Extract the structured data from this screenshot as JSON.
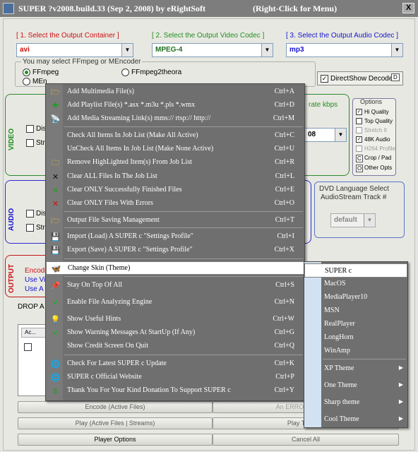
{
  "window": {
    "title": "SUPER ?v2008.build.33 (Sep 2, 2008) by eRightSoft",
    "hint": "(Right-Click for Menu)",
    "close": "X"
  },
  "top": {
    "container_label": "[ 1.     Select the Output Container ]",
    "video_codec_label": "[ 2.    Select the Output Video Codec ]",
    "audio_codec_label": "[ 3.    Select the Output Audio Codec ]",
    "container_value": "avi",
    "video_codec_value": "MPEG-4",
    "audio_codec_value": "mp3"
  },
  "encoder": {
    "caption": "You may select FFmpeg or MEncoder",
    "ffmpeg": "FFmpeg",
    "ffmpeg2theora": "FFmpeg2theora",
    "mencoder": "MEn"
  },
  "directshow": {
    "label": "DirectShow Decode",
    "badge": "D"
  },
  "video": {
    "section": "VIDEO",
    "disable": "Disa",
    "stream": "Stre",
    "bitrate": "rate  kbps",
    "value": "08"
  },
  "options": {
    "title": "Options",
    "hi_quality": "Hi Quality",
    "top_quality": "Top Quality",
    "stretch": "Stretch It",
    "audio_48k": "48K Audio",
    "h264": "H264 Profile",
    "crop_badge": "C",
    "crop": "Crop / Pad",
    "other_badge": "O",
    "other": "Other Opts"
  },
  "audio": {
    "section": "AUDIO",
    "disable": "Disa",
    "stream": "Stre"
  },
  "dvd": {
    "title": "DVD Language Select",
    "subtitle": "AudioStream  Track #",
    "value": "default"
  },
  "output": {
    "section": "OUTPUT",
    "encode_line": "Encode",
    "usevi_line": "Use Vi",
    "useav_line": "Use A"
  },
  "drop": {
    "text": "DROP A"
  },
  "list": {
    "header": "Ac..."
  },
  "buttons": {
    "encode": "Encode (Active Files)",
    "error": "An ERROR has occu",
    "play": "Play (Active Files | Streams)",
    "play_last": "Play The Las",
    "player_options": "Player Options",
    "cancel": "Cancel All"
  },
  "context_menu": [
    {
      "icon": "folder-add-icon",
      "glyph": "🗁",
      "text": "Add Multimedia File(s)",
      "shortcut": "Ctrl+A"
    },
    {
      "icon": "plus-icon",
      "glyph": "✚",
      "text": "Add Playlist File(s)    *.asx  *.m3u  *.pls  *.wmx",
      "shortcut": "Ctrl+D"
    },
    {
      "icon": "satellite-icon",
      "glyph": "📡",
      "text": "Add Media Streaming Link(s)    mms://  rtsp://  http://",
      "shortcut": "Ctrl+M"
    },
    {
      "icon": "",
      "glyph": "",
      "text": "Check All Items In Job List (Make All Active)",
      "shortcut": "Ctrl+C"
    },
    {
      "icon": "",
      "glyph": "",
      "text": "UnCheck All Items In Job List (Make None Active)",
      "shortcut": "Ctrl+U"
    },
    {
      "icon": "folder-icon",
      "glyph": "🗀",
      "text": "Remove HighLighted Item(s) From Job List",
      "shortcut": "Ctrl+R"
    },
    {
      "icon": "x-mark-icon",
      "glyph": "✕",
      "text": "Clear ALL Files In The Job List",
      "shortcut": "Ctrl+L"
    },
    {
      "icon": "x-mark-green-icon",
      "glyph": "✕",
      "text": "Clear ONLY Successfully Finished Files",
      "shortcut": "Ctrl+E"
    },
    {
      "icon": "x-mark-red-icon",
      "glyph": "✕",
      "text": "Clear ONLY Files With Errors",
      "shortcut": "Ctrl+O"
    },
    {
      "icon": "folder-open-icon",
      "glyph": "🗁",
      "text": "Output File Saving Management",
      "shortcut": "Ctrl+T"
    },
    {
      "icon": "floppy-icon",
      "glyph": "💾",
      "text": "Import (Load) A SUPER c \"Settings Profile\"",
      "shortcut": "Ctrl+I"
    },
    {
      "icon": "floppy-icon",
      "glyph": "💾",
      "text": "Export (Save) A SUPER c \"Settings Profile\"",
      "shortcut": "Ctrl+X"
    },
    {
      "icon": "butterfly-icon",
      "glyph": "🦋",
      "text": "Change Skin (Theme)",
      "shortcut": ""
    },
    {
      "icon": "pin-icon",
      "glyph": "📌",
      "text": "Stay On Top Of All",
      "shortcut": "Ctrl+S"
    },
    {
      "icon": "checkmark-icon",
      "glyph": "✔",
      "text": "Enable File Analyzing Engine",
      "shortcut": "Ctrl+N"
    },
    {
      "icon": "lightbulb-icon",
      "glyph": "💡",
      "text": "Show Useful Hints",
      "shortcut": "Ctrl+W"
    },
    {
      "icon": "checkmark-icon",
      "glyph": "✔",
      "text": "Show Warning Messages At StartUp (If Any)",
      "shortcut": "Ctrl+G"
    },
    {
      "icon": "",
      "glyph": "",
      "text": "Show Credit Screen On Quit",
      "shortcut": "Ctrl+Q"
    },
    {
      "icon": "globe-icon",
      "glyph": "🌐",
      "text": "Check For Latest SUPER c Update",
      "shortcut": "Ctrl+K"
    },
    {
      "icon": "globe-icon",
      "glyph": "🌐",
      "text": "SUPER c Official Website",
      "shortcut": "Ctrl+P"
    },
    {
      "icon": "dollar-icon",
      "glyph": "$",
      "text": "Thank You For Your Kind Donation To Support SUPER c",
      "shortcut": "Ctrl+Y"
    }
  ],
  "skin_menu": [
    {
      "text": "SUPER c",
      "submenu": false
    },
    {
      "text": "MacOS",
      "submenu": false
    },
    {
      "text": "MediaPlayer10",
      "submenu": false
    },
    {
      "text": "MSN",
      "submenu": false
    },
    {
      "text": "RealPlayer",
      "submenu": false
    },
    {
      "text": "LongHorn",
      "submenu": false
    },
    {
      "text": "WinAmp",
      "submenu": false
    },
    {
      "text": "XP Theme",
      "submenu": true
    },
    {
      "text": "One Theme",
      "submenu": true
    },
    {
      "text": "Sharp theme",
      "submenu": true
    },
    {
      "text": "Cool Theme",
      "submenu": true
    }
  ],
  "colors": {
    "menu_bg": "#6f6f6f",
    "menu_text": "#ffffff",
    "highlight": "#ffffff",
    "accent_red": "#cc1010",
    "accent_green": "#1f8f1f",
    "accent_blue": "#1515cc"
  }
}
